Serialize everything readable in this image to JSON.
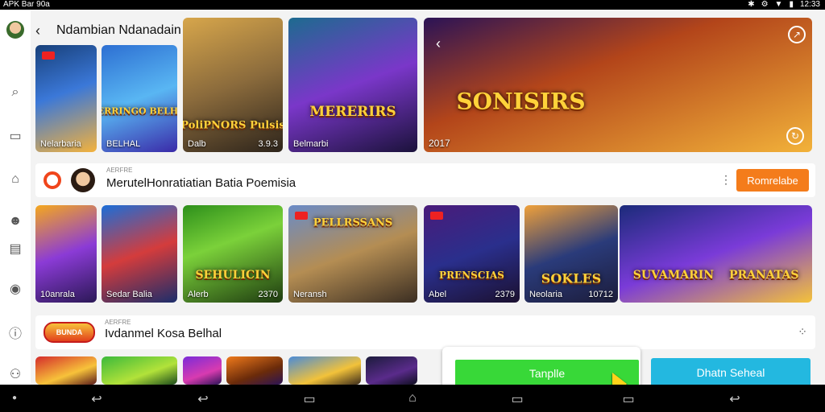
{
  "status_bar": {
    "left_text": "APK Bar 90a",
    "time": "12:33"
  },
  "header": {
    "back_glyph": "‹",
    "title": "Ndambian Ndanadain"
  },
  "featured": {
    "tiles": [
      {
        "caption": "Nelarbaria",
        "caption_right": ""
      },
      {
        "caption": "BELHAL",
        "caption_right": ""
      },
      {
        "caption": "Dalb",
        "caption_right": "3.9.3"
      },
      {
        "caption": "Belmarbi",
        "caption_right": ""
      },
      {
        "caption": "2017",
        "caption_right": ""
      }
    ],
    "logos": [
      "MERRINGO BELHAL",
      "PoliPNORS Pulsis",
      "MERERIRS",
      "SONISIRS"
    ]
  },
  "section1": {
    "small_text": "AERFRE",
    "title": "MerutelHonratiatian Batia Poemisia",
    "button": "Romrelabe",
    "tiles": [
      {
        "caption": "10anrala",
        "caption_right": ""
      },
      {
        "caption": "Sedar Balia",
        "caption_right": ""
      },
      {
        "caption": "Alerb",
        "caption_right": "2370"
      },
      {
        "caption": "Neransh",
        "caption_right": ""
      },
      {
        "caption": "Abel",
        "caption_right": "2379"
      },
      {
        "caption": "Neolaria",
        "caption_right": "10712"
      },
      {
        "caption": "",
        "caption_right": ""
      }
    ],
    "logos": [
      "SEHULICIN",
      "PELLRSSANS",
      "PRENSCIAS",
      "SOKLES",
      "SUVAMARIN",
      "PRANATAS"
    ]
  },
  "section2": {
    "small_text": "AERFRE",
    "title": "Ivdanmel Kosa Belhal",
    "logo_text": "BUNDA"
  },
  "overlay": {
    "green_button": "Tanplle",
    "cyan_button": "Dhatn Seheal"
  },
  "colors": {
    "orange": "#f47c1b",
    "green": "#38d838",
    "cyan": "#23b8e0",
    "red_ring": "#f0451b"
  }
}
